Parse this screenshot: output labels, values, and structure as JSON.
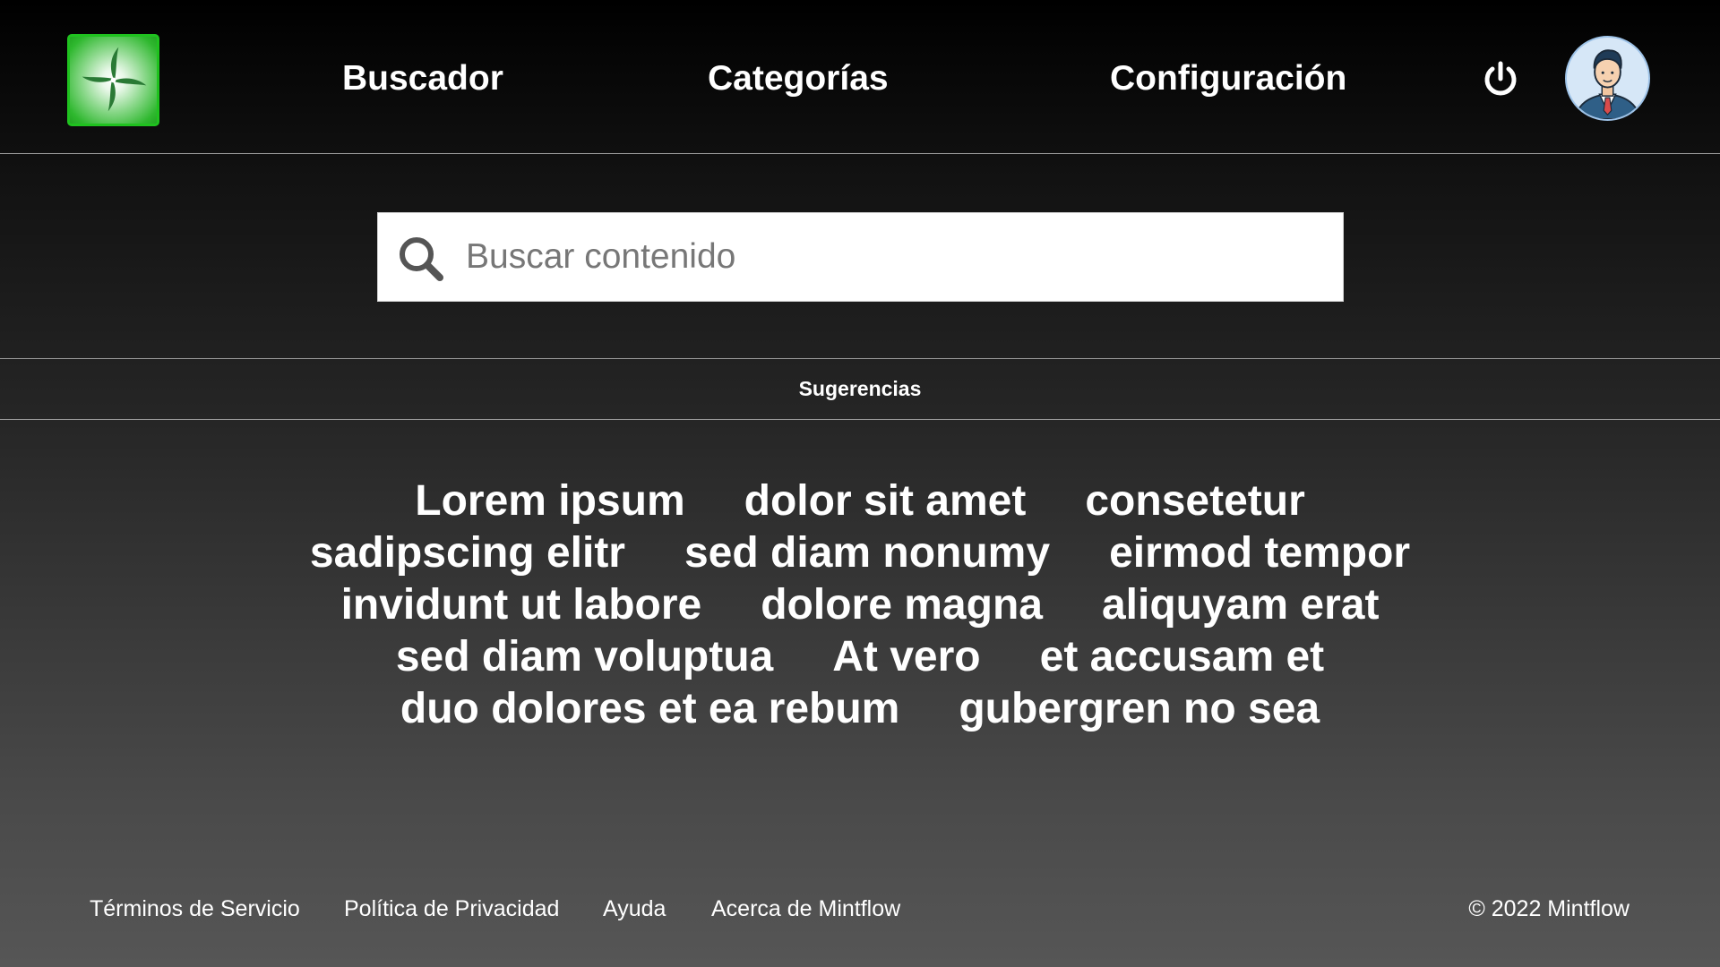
{
  "header": {
    "logo_icon": "pinwheel-logo",
    "nav": [
      {
        "label": "Buscador"
      },
      {
        "label": "Categorías"
      },
      {
        "label": "Configuración"
      }
    ],
    "power_icon": "power-icon",
    "avatar_icon": "user-avatar"
  },
  "search": {
    "placeholder": "Buscar contenido",
    "value": "",
    "icon": "search-icon"
  },
  "suggestions": {
    "title": "Sugerencias",
    "rows": [
      [
        "Lorem ipsum",
        "dolor sit amet",
        "consetetur"
      ],
      [
        "sadipscing elitr",
        "sed diam nonumy",
        "eirmod tempor"
      ],
      [
        "invidunt ut labore",
        "dolore magna",
        "aliquyam erat"
      ],
      [
        "sed diam voluptua",
        "At vero",
        "et accusam et"
      ],
      [
        "duo dolores et ea rebum",
        "gubergren no sea"
      ]
    ]
  },
  "footer": {
    "links": [
      {
        "label": "Términos de Servicio"
      },
      {
        "label": "Política de Privacidad"
      },
      {
        "label": "Ayuda"
      },
      {
        "label": "Acerca de Mintflow"
      }
    ],
    "copyright": "© 2022 Mintflow"
  },
  "colors": {
    "logo_green": "#1fc21f",
    "text": "#ffffff",
    "search_bg": "#ffffff"
  }
}
